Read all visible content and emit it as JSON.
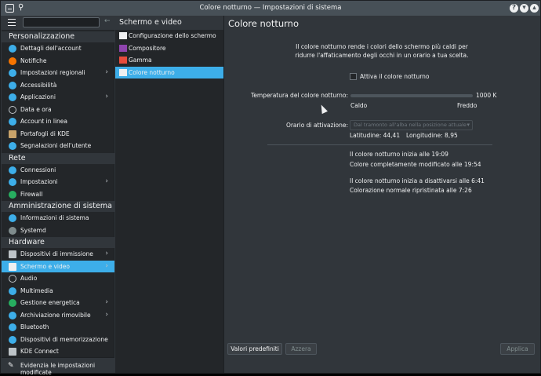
{
  "window": {
    "title": "Colore notturno — Impostazioni di sistema"
  },
  "sidebar": {
    "categories": [
      {
        "name": "Personalizzazione",
        "items": [
          {
            "label": "Dettagli dell'account",
            "icon": "account-icon",
            "color": "#3daee9",
            "chevron": false
          },
          {
            "label": "Notifiche",
            "icon": "bell-icon",
            "color": "#f67400",
            "chevron": false
          },
          {
            "label": "Impostazioni regionali",
            "icon": "globe-icon",
            "color": "#3daee9",
            "chevron": true
          },
          {
            "label": "Accessibilità",
            "icon": "accessibility-icon",
            "color": "#3daee9",
            "chevron": false
          },
          {
            "label": "Applicazioni",
            "icon": "applications-icon",
            "color": "#3daee9",
            "chevron": true
          },
          {
            "label": "Data e ora",
            "icon": "clock-icon",
            "color": "#232629",
            "chevron": false
          },
          {
            "label": "Account in linea",
            "icon": "online-accounts-icon",
            "color": "#3daee9",
            "chevron": false
          },
          {
            "label": "Portafogli di KDE",
            "icon": "wallet-icon",
            "color": "#c9a36a",
            "chevron": false
          },
          {
            "label": "Segnalazioni dell'utente",
            "icon": "feedback-icon",
            "color": "#3daee9",
            "chevron": false
          }
        ]
      },
      {
        "name": "Rete",
        "items": [
          {
            "label": "Connessioni",
            "icon": "network-icon",
            "color": "#3daee9",
            "chevron": false
          },
          {
            "label": "Impostazioni",
            "icon": "network-settings-icon",
            "color": "#3daee9",
            "chevron": true
          },
          {
            "label": "Firewall",
            "icon": "firewall-icon",
            "color": "#27ae60",
            "chevron": false
          }
        ]
      },
      {
        "name": "Amministrazione di sistema",
        "items": [
          {
            "label": "Informazioni di sistema",
            "icon": "info-icon",
            "color": "#3daee9",
            "chevron": false
          },
          {
            "label": "Systemd",
            "icon": "systemd-icon",
            "color": "#7f8c8d",
            "chevron": false
          }
        ]
      },
      {
        "name": "Hardware",
        "items": [
          {
            "label": "Dispositivi di immissione",
            "icon": "keyboard-icon",
            "color": "#bdc3c7",
            "chevron": true
          },
          {
            "label": "Schermo e video",
            "icon": "monitor-icon",
            "color": "#eff0f1",
            "chevron": true,
            "active": true
          },
          {
            "label": "Audio",
            "icon": "speaker-icon",
            "color": "#232629",
            "chevron": false
          },
          {
            "label": "Multimedia",
            "icon": "multimedia-icon",
            "color": "#3daee9",
            "chevron": false
          },
          {
            "label": "Gestione energetica",
            "icon": "battery-icon",
            "color": "#27ae60",
            "chevron": true
          },
          {
            "label": "Archiviazione rimovibile",
            "icon": "usb-icon",
            "color": "#3daee9",
            "chevron": true
          },
          {
            "label": "Bluetooth",
            "icon": "bluetooth-icon",
            "color": "#3daee9",
            "chevron": false
          },
          {
            "label": "Dispositivi di memorizzazione",
            "icon": "storage-icon",
            "color": "#3daee9",
            "chevron": false
          },
          {
            "label": "KDE Connect",
            "icon": "kdeconnect-icon",
            "color": "#bdc3c7",
            "chevron": false
          }
        ]
      }
    ],
    "footer_label": "Evidenzia le impostazioni modificate"
  },
  "subcategory": {
    "title": "Schermo e video",
    "items": [
      {
        "label": "Configurazione dello schermo",
        "icon": "display-config-icon"
      },
      {
        "label": "Compositore",
        "icon": "compositor-icon"
      },
      {
        "label": "Gamma",
        "icon": "gamma-icon"
      },
      {
        "label": "Colore notturno",
        "icon": "night-color-icon",
        "active": true
      }
    ]
  },
  "main": {
    "title": "Colore notturno",
    "description_line1": "Il colore notturno rende i colori dello schermo più caldi per",
    "description_line2": "ridurre l'affaticamento degli occhi in un orario a tua scelta.",
    "activate_label": "Attiva il colore notturno",
    "activate_checked": false,
    "temperature_label": "Temperatura del colore notturno:",
    "temperature_value": "1000 K",
    "warm_label": "Caldo",
    "cool_label": "Freddo",
    "activation_label": "Orario di attivazione:",
    "activation_value": "Dal tramonto all'alba nella posizione attuale",
    "latitude": "Latitudine: 44,41",
    "longitude": "Longitudine: 8,95",
    "schedule": [
      "Il colore notturno inizia alle 19:09",
      "Colore completamente modificato alle 19:54",
      "Il colore notturno inizia a disattivarsi alle 6:41",
      "Colorazione normale ripristinata alle 7:26"
    ]
  },
  "buttons": {
    "defaults": "Valori predefiniti",
    "reset": "Azzera",
    "apply": "Applica"
  }
}
